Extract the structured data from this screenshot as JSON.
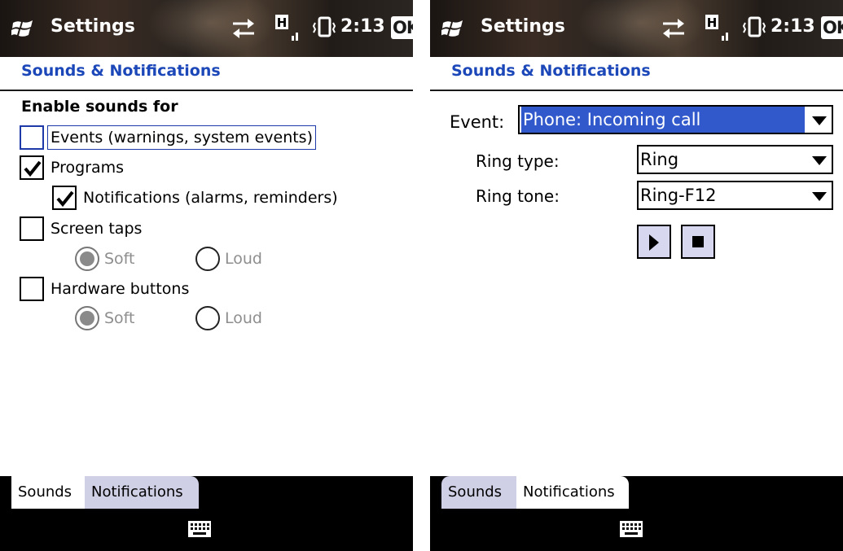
{
  "left": {
    "title_bar": {
      "app_title": "Settings",
      "clock": "2:13",
      "ok_label": "OK",
      "icons": [
        "windows-logo-icon",
        "sync-arrows-icon",
        "signal-h-icon",
        "vibrate-icon"
      ]
    },
    "page_heading": "Sounds & Notifications",
    "section_label": "Enable sounds for",
    "options": [
      {
        "label": "Events (warnings, system events)",
        "checked": false,
        "focused": true
      },
      {
        "label": "Programs",
        "checked": true
      },
      {
        "label": "Notifications (alarms, reminders)",
        "checked": true
      },
      {
        "label": "Screen taps",
        "checked": false
      },
      {
        "label": "Hardware buttons",
        "checked": false
      }
    ],
    "screen_taps_radios": [
      {
        "label": "Soft",
        "selected": true,
        "disabled": true
      },
      {
        "label": "Loud",
        "selected": false,
        "disabled": true
      }
    ],
    "hardware_radios": [
      {
        "label": "Soft",
        "selected": true,
        "disabled": true
      },
      {
        "label": "Loud",
        "selected": false,
        "disabled": true
      }
    ],
    "tabs": [
      {
        "label": "Sounds",
        "active": true
      },
      {
        "label": "Notifications",
        "active": false
      }
    ]
  },
  "right": {
    "title_bar": {
      "app_title": "Settings",
      "clock": "2:13",
      "ok_label": "OK"
    },
    "page_heading": "Sounds & Notifications",
    "event_label": "Event:",
    "event_value": "Phone: Incoming call",
    "ring_type_label": "Ring type:",
    "ring_type_value": "Ring",
    "ring_tone_label": "Ring tone:",
    "ring_tone_value": "Ring-F12",
    "tabs": [
      {
        "label": "Sounds",
        "active": false
      },
      {
        "label": "Notifications",
        "active": true
      }
    ]
  },
  "colors": {
    "heading_blue": "#1b47b8",
    "selection_blue": "#3159cc",
    "tab_lavender": "#cfcfe6",
    "disabled_gray": "#8e8e8e"
  }
}
